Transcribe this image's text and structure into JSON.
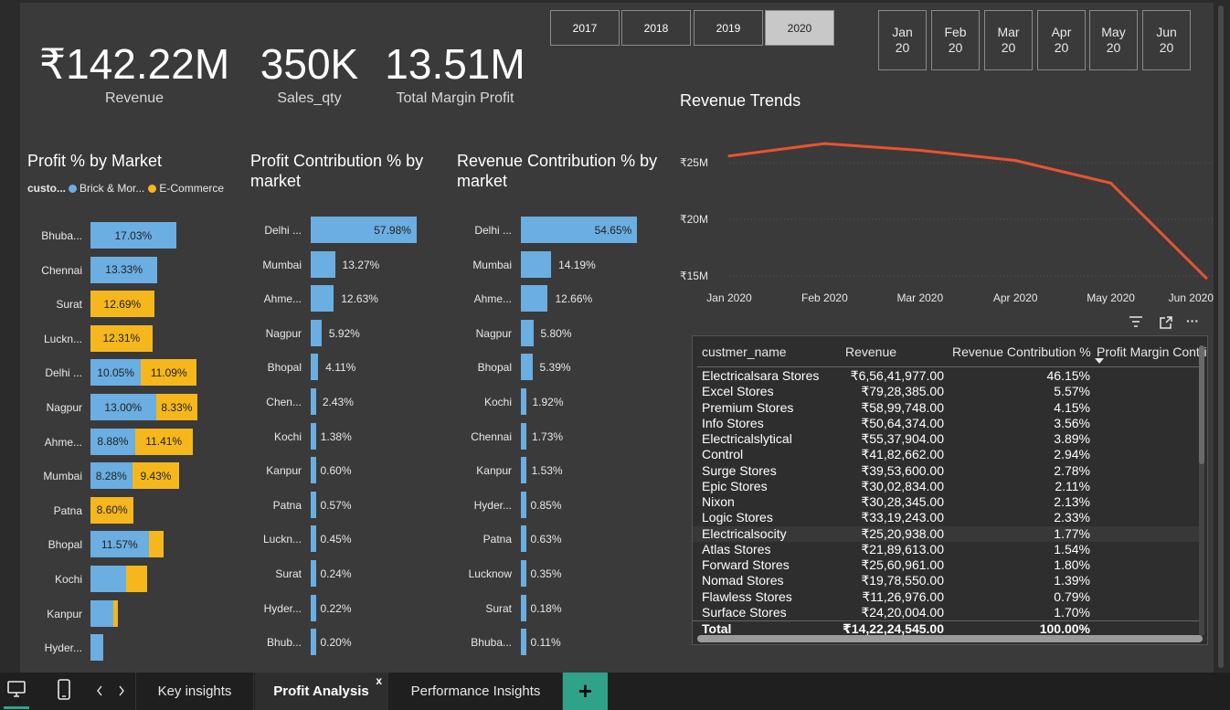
{
  "kpis": [
    {
      "value": "₹142.22M",
      "label": "Revenue"
    },
    {
      "value": "350K",
      "label": "Sales_qty"
    },
    {
      "value": "13.51M",
      "label": "Total Margin Profit"
    }
  ],
  "years": [
    "2017",
    "2018",
    "2019",
    "2020"
  ],
  "selected_year": "2020",
  "months": [
    {
      "m": "Jan",
      "y": "20"
    },
    {
      "m": "Feb",
      "y": "20"
    },
    {
      "m": "Mar",
      "y": "20"
    },
    {
      "m": "Apr",
      "y": "20"
    },
    {
      "m": "May",
      "y": "20"
    },
    {
      "m": "Jun",
      "y": "20"
    }
  ],
  "profit_by_market": {
    "title": "Profit % by Market",
    "legend_title": "custo...",
    "legend": [
      "Brick & Mor...",
      "E-Commerce"
    ]
  },
  "profit_contribution": {
    "title_line1": "Profit Contribution % by",
    "title_line2": "market"
  },
  "revenue_contribution": {
    "title_line1": "Revenue Contribution % by",
    "title_line2": "market"
  },
  "revenue_trends": {
    "title": "Revenue Trends"
  },
  "colors": {
    "brick": "#6aaee2",
    "ecom": "#f5b71c",
    "line": "#e8542f",
    "add_tab": "#2fa38a"
  },
  "chart_data": [
    {
      "type": "bar",
      "title": "Profit % by Market",
      "categories": [
        "Bhuba...",
        "Chennai",
        "Surat",
        "Luckn...",
        "Delhi ...",
        "Nagpur",
        "Ahme...",
        "Mumbai",
        "Patna",
        "Bhopal",
        "Kochi",
        "Kanpur",
        "Hyder..."
      ],
      "series": [
        {
          "name": "Brick & Mor...",
          "values": [
            17.03,
            13.33,
            0,
            0,
            10.05,
            13.0,
            8.88,
            8.28,
            0,
            11.57,
            7.0,
            4.6,
            2.5
          ],
          "labels": [
            "17.03%",
            "13.33%",
            "",
            "",
            "10.05%",
            "13.00%",
            "8.88%",
            "8.28%",
            "",
            "11.57%",
            "",
            "",
            ""
          ]
        },
        {
          "name": "E-Commerce",
          "values": [
            0,
            0,
            12.69,
            12.31,
            11.09,
            8.33,
            11.41,
            9.43,
            8.6,
            3.0,
            4.2,
            0.8,
            0
          ],
          "labels": [
            "",
            "",
            "12.69%",
            "12.31%",
            "11.09%",
            "8.33%",
            "11.41%",
            "9.43%",
            "8.60%",
            "",
            "",
            "",
            ""
          ]
        }
      ],
      "stacked": true,
      "orientation": "horizontal"
    },
    {
      "type": "bar",
      "title": "Profit Contribution % by market",
      "categories": [
        "Delhi ...",
        "Mumbai",
        "Ahme...",
        "Nagpur",
        "Bhopal",
        "Chen...",
        "Kochi",
        "Kanpur",
        "Patna",
        "Luckn...",
        "Surat",
        "Hyder...",
        "Bhub..."
      ],
      "values": [
        57.98,
        13.27,
        12.63,
        5.92,
        4.11,
        2.43,
        1.38,
        0.6,
        0.57,
        0.45,
        0.24,
        0.22,
        0.2
      ],
      "labels": [
        "57.98%",
        "13.27%",
        "12.63%",
        "5.92%",
        "4.11%",
        "2.43%",
        "1.38%",
        "0.60%",
        "0.57%",
        "0.45%",
        "0.24%",
        "0.22%",
        "0.20%"
      ],
      "orientation": "horizontal"
    },
    {
      "type": "bar",
      "title": "Revenue Contribution % by market",
      "categories": [
        "Delhi ...",
        "Mumbai",
        "Ahme...",
        "Nagpur",
        "Bhopal",
        "Kochi",
        "Chennai",
        "Kanpur",
        "Hyder...",
        "Patna",
        "Lucknow",
        "Surat",
        "Bhuba..."
      ],
      "values": [
        54.65,
        14.19,
        12.66,
        5.8,
        5.39,
        1.92,
        1.73,
        1.53,
        0.85,
        0.63,
        0.35,
        0.18,
        0.11
      ],
      "labels": [
        "54.65%",
        "14.19%",
        "12.66%",
        "5.80%",
        "5.39%",
        "1.92%",
        "1.73%",
        "1.53%",
        "0.85%",
        "0.63%",
        "0.35%",
        "0.18%",
        "0.11%"
      ],
      "orientation": "horizontal"
    },
    {
      "type": "line",
      "title": "Revenue Trends",
      "x": [
        "Jan 2020",
        "Feb 2020",
        "Mar 2020",
        "Apr 2020",
        "May 2020",
        "Jun 2020"
      ],
      "series": [
        {
          "values": [
            25.6,
            26.7,
            26.1,
            25.2,
            23.2,
            14.8
          ]
        }
      ],
      "yticks": [
        "₹15M",
        "₹20M",
        "₹25M"
      ],
      "ytick_values": [
        15,
        20,
        25
      ],
      "ylim": [
        14.5,
        28
      ],
      "grid": true
    }
  ],
  "table": {
    "columns": [
      "custmer_name",
      "Revenue",
      "Revenue Contribution %",
      "Profit Margin Contri"
    ],
    "rows": [
      [
        "Electricalsara Stores",
        "₹6,56,41,977.00",
        "46.15%"
      ],
      [
        "Excel Stores",
        "₹79,28,385.00",
        "5.57%"
      ],
      [
        "Premium Stores",
        "₹58,99,748.00",
        "4.15%"
      ],
      [
        "Info Stores",
        "₹50,64,374.00",
        "3.56%"
      ],
      [
        "Electricalslytical",
        "₹55,37,904.00",
        "3.89%"
      ],
      [
        "Control",
        "₹41,82,662.00",
        "2.94%"
      ],
      [
        "Surge Stores",
        "₹39,53,600.00",
        "2.78%"
      ],
      [
        "Epic Stores",
        "₹30,02,834.00",
        "2.11%"
      ],
      [
        "Nixon",
        "₹30,28,345.00",
        "2.13%"
      ],
      [
        "Logic Stores",
        "₹33,19,243.00",
        "2.33%"
      ],
      [
        "Electricalsocity",
        "₹25,20,938.00",
        "1.77%"
      ],
      [
        "Atlas Stores",
        "₹21,89,613.00",
        "1.54%"
      ],
      [
        "Forward Stores",
        "₹25,60,961.00",
        "1.80%"
      ],
      [
        "Nomad Stores",
        "₹19,78,550.00",
        "1.39%"
      ],
      [
        "Flawless Stores",
        "₹11,26,976.00",
        "0.79%"
      ],
      [
        "Surface Stores",
        "₹24,20,004.00",
        "1.70%"
      ]
    ],
    "highlight_row": 10,
    "total": [
      "Total",
      "₹14,22,24,545.00",
      "100.00%"
    ]
  },
  "tabs": {
    "items": [
      "Key insights",
      "Profit Analysis",
      "Performance Insights"
    ],
    "active": "Profit Analysis",
    "close_label": "x",
    "add_label": "+"
  }
}
